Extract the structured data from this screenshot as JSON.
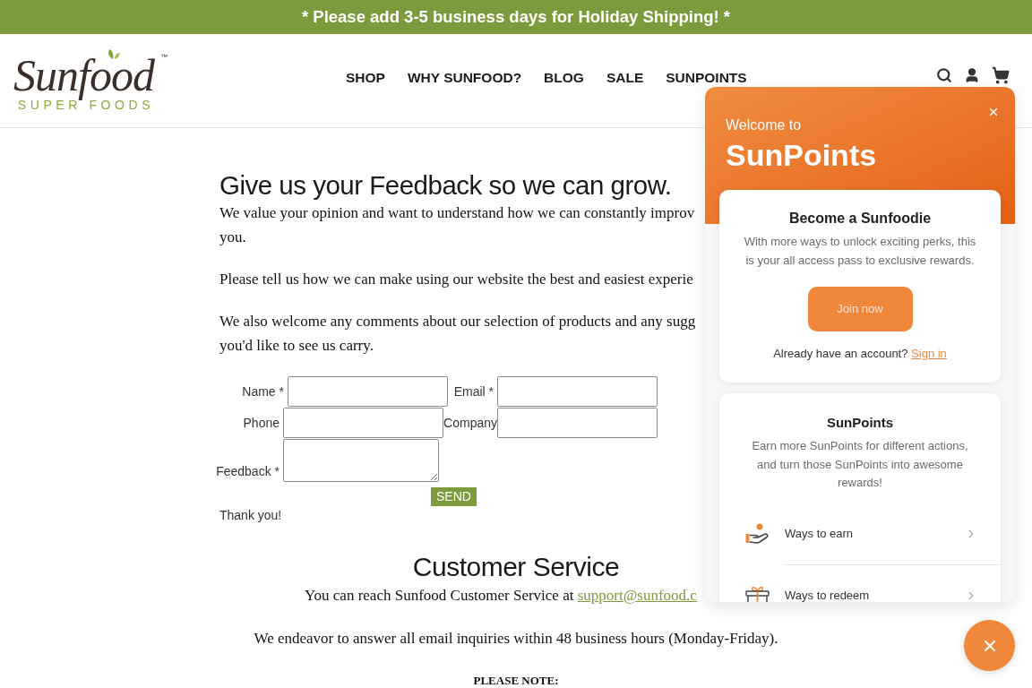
{
  "announcement": {
    "text": "* Please add 3-5 business days for Holiday Shipping! *"
  },
  "header": {
    "logo": {
      "wordmark": "Sunfood",
      "trademark": "™",
      "tagline": "SUPER FOODS"
    },
    "nav": [
      {
        "label": "SHOP"
      },
      {
        "label": "WHY SUNFOOD?"
      },
      {
        "label": "BLOG"
      },
      {
        "label": "SALE"
      },
      {
        "label": "SUNPOINTS"
      }
    ]
  },
  "feedback": {
    "heading": "Give us your Feedback so we can grow.",
    "paragraphs": [
      {
        "lines": [
          "We value your opinion and want to understand how we can constantly improv",
          "you."
        ]
      },
      {
        "lines": [
          "Please tell us how we can make using our website the best and easiest experie"
        ]
      },
      {
        "lines": [
          "We also welcome any comments about our selection of products and any sugg",
          "you'd like to see us carry."
        ]
      }
    ],
    "form": {
      "rows": [
        {
          "fields": [
            {
              "label": "Name *",
              "kind": "input"
            },
            {
              "label": "Email *",
              "kind": "input"
            }
          ]
        },
        {
          "fields": [
            {
              "label": "Phone",
              "kind": "input"
            },
            {
              "label": "Company",
              "kind": "input"
            }
          ]
        },
        {
          "fields": [
            {
              "label": "Feedback *",
              "kind": "textarea"
            }
          ]
        }
      ],
      "submit": "SEND",
      "thanks": "Thank you!"
    }
  },
  "customer_service": {
    "heading": "Customer Service",
    "contact": {
      "text": "You can reach Sunfood Customer Service at",
      "link": "support@sunfood.c"
    },
    "hours": "We endeavor to answer all email inquiries within 48 business hours (Monday-Friday).",
    "note": "PLEASE NOTE:"
  },
  "rewards_popup": {
    "open": true,
    "greeting": "Welcome to",
    "title": "SunPoints",
    "join_card": {
      "heading": "Become a Sunfoodie",
      "text": "With more ways to unlock exciting perks, this is your all access pass to exclusive rewards.",
      "button": "Join now",
      "signin_prompt": "Already have an account?",
      "signin_link": "Sign in"
    },
    "points_card": {
      "heading": "SunPoints",
      "text": "Earn more SunPoints for different actions, and turn those SunPoints into awesome rewards!",
      "links": [
        {
          "label": "Ways to earn",
          "kind": "earn"
        },
        {
          "label": "Ways to redeem",
          "kind": "redeem"
        }
      ]
    }
  }
}
